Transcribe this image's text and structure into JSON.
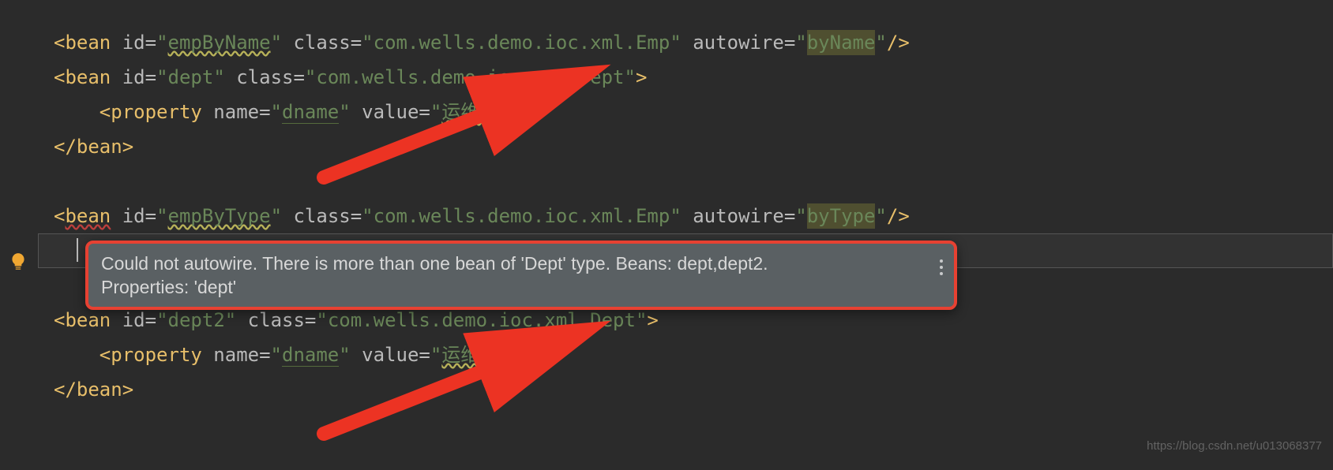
{
  "lines": {
    "l1": {
      "open": "<",
      "tag": "bean",
      "sp": " ",
      "id_attr": "id",
      "eq": "=",
      "q": "\"",
      "id_val": "empByName",
      "class_attr": "class",
      "class_val": "com.wells.demo.ioc.xml.Emp",
      "autowire_attr": "autowire",
      "autowire_val": "byName",
      "close": "/>"
    },
    "l2": {
      "open": "<",
      "tag": "bean",
      "sp": " ",
      "id_attr": "id",
      "id_val": "dept",
      "class_attr": "class",
      "class_val": "com.wells.demo.ioc.xml.Dept",
      "close": ">"
    },
    "l3": {
      "indent": "    ",
      "open": "<",
      "tag": "property",
      "sp": " ",
      "name_attr": "name",
      "name_val": "dname",
      "value_attr": "value",
      "value_val": "运维部",
      "close": "/>"
    },
    "l4": {
      "open": "</",
      "tag": "bean",
      "close": ">"
    },
    "l5": {
      "open": "<",
      "tag": "bean",
      "sp": " ",
      "id_attr": "id",
      "id_val": "empByType",
      "class_attr": "class",
      "class_val": "com.wells.demo.ioc.xml.Emp",
      "autowire_attr": "autowire",
      "autowire_val": "byType",
      "close": "/>"
    },
    "l7": {
      "open": "<",
      "tag": "bean",
      "sp": " ",
      "id_attr": "id",
      "id_val": "dept2",
      "class_attr": "class",
      "class_val": "com.wells.demo.ioc.xml.Dept",
      "close": ">"
    },
    "l8": {
      "indent": "    ",
      "open": "<",
      "tag": "property",
      "sp": " ",
      "name_attr": "name",
      "name_val": "dname",
      "value_attr": "value",
      "value_val": "运维部",
      "close": "/>"
    },
    "l9": {
      "open": "</",
      "tag": "bean",
      "close": ">"
    }
  },
  "q": "\"",
  "eq": "=",
  "tooltip": {
    "line1": "Could not autowire. There is more than one bean of 'Dept' type. Beans: dept,dept2.",
    "line2": "Properties: 'dept'"
  },
  "watermark": "https://blog.csdn.net/u013068377"
}
